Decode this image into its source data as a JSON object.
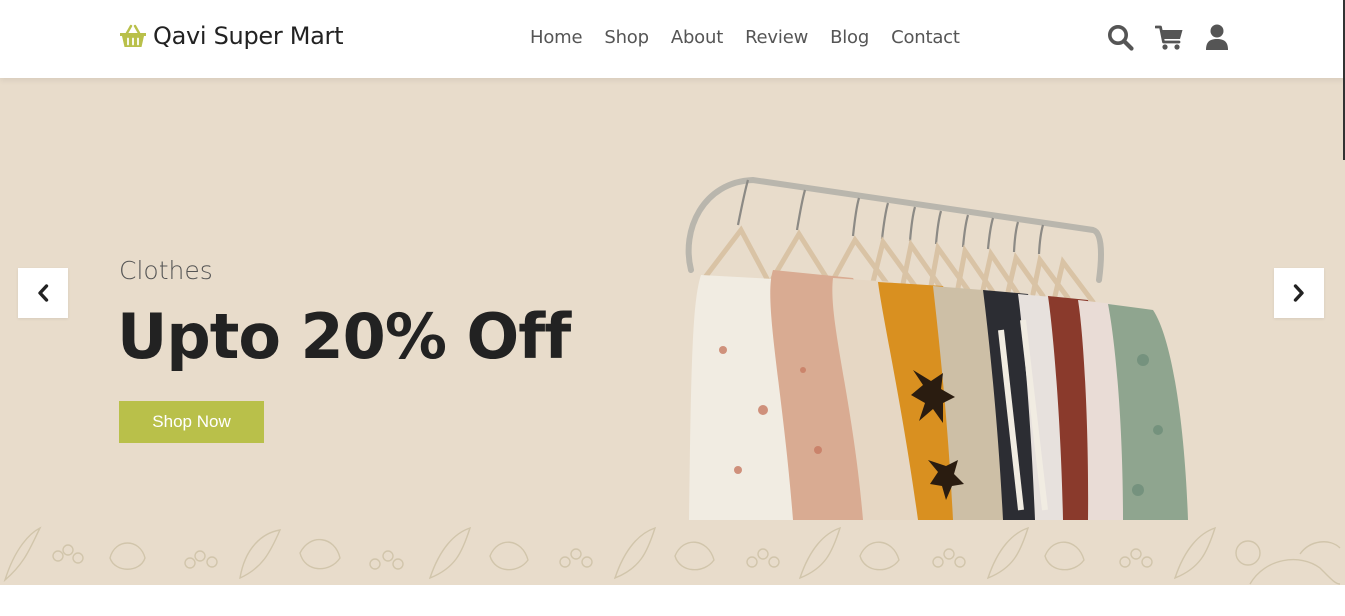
{
  "header": {
    "brand": "Qavi Super Mart",
    "brand_icon": "shopping-basket-icon",
    "nav": [
      {
        "label": "Home"
      },
      {
        "label": "Shop"
      },
      {
        "label": "About"
      },
      {
        "label": "Review"
      },
      {
        "label": "Blog"
      },
      {
        "label": "Contact"
      }
    ],
    "icons": [
      "search-icon",
      "cart-icon",
      "user-icon"
    ]
  },
  "hero": {
    "category": "Clothes",
    "headline": "Upto 20% Off",
    "cta_label": "Shop Now",
    "prev_icon": "chevron-left-icon",
    "next_icon": "chevron-right-icon"
  },
  "colors": {
    "accent": "#b9c04a",
    "hero_bg": "#e8dccb",
    "text_dark": "#222222",
    "nav_text": "#555555"
  }
}
